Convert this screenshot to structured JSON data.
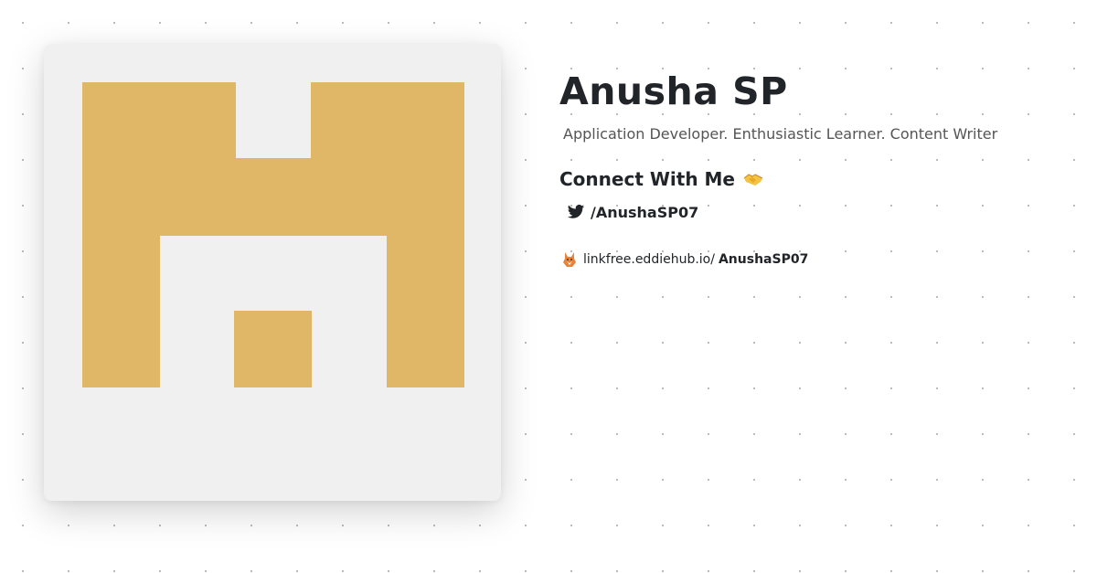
{
  "profile": {
    "name": "Anusha SP",
    "bio": "Application Developer. Enthusiastic Learner. Content Writer"
  },
  "connect": {
    "heading": "Connect With Me",
    "emoji_icon": "handshake-icon",
    "links": [
      {
        "icon": "twitter-icon",
        "label": "/AnushaSP07"
      }
    ]
  },
  "footer": {
    "icon": "fox-icon",
    "domain": "linkfree.eddiehub.io/",
    "handle": "AnushaSP07"
  },
  "colors": {
    "avatar_background": "#f0f0f0",
    "avatar_pattern": "#e0b767",
    "text": "#212529",
    "muted_text": "#555555",
    "twitter": "#212529"
  }
}
